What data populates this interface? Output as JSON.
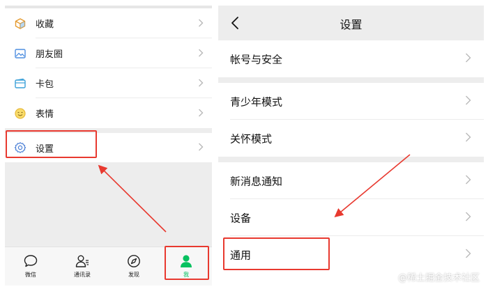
{
  "left": {
    "menu": [
      {
        "label": "收藏",
        "icon": "favorites-cube-icon"
      },
      {
        "label": "朋友圈",
        "icon": "moments-picture-icon"
      },
      {
        "label": "卡包",
        "icon": "card-wallet-icon"
      },
      {
        "label": "表情",
        "icon": "emoji-face-icon"
      }
    ],
    "settings_item": {
      "label": "设置",
      "icon": "gear-icon"
    },
    "tabbar": [
      {
        "label": "微信",
        "icon": "chat-bubble-icon"
      },
      {
        "label": "通讯录",
        "icon": "contacts-icon"
      },
      {
        "label": "发现",
        "icon": "compass-icon"
      },
      {
        "label": "我",
        "icon": "person-icon",
        "active": true
      }
    ]
  },
  "right": {
    "title": "设置",
    "groups": [
      [
        "帐号与安全"
      ],
      [
        "青少年模式",
        "关怀模式"
      ],
      [
        "新消息通知",
        "设备",
        "通用"
      ]
    ]
  },
  "colors": {
    "accent_green": "#07c160",
    "highlight_red": "#e8392f",
    "page_background": "#ededed"
  },
  "watermark": "@稀土掘金技术社区"
}
